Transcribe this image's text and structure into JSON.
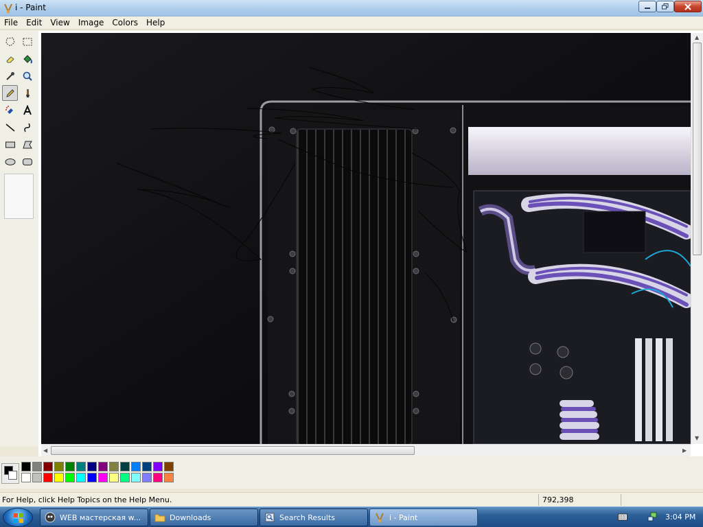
{
  "window": {
    "title": "i - Paint"
  },
  "menu": [
    "File",
    "Edit",
    "View",
    "Image",
    "Colors",
    "Help"
  ],
  "tools": [
    "free-form-select",
    "select",
    "eraser",
    "fill-with-color",
    "pick-color",
    "magnifier",
    "pencil",
    "brush",
    "airbrush",
    "text",
    "line",
    "curve",
    "rectangle",
    "polygon",
    "ellipse",
    "rounded-rectangle"
  ],
  "selected_tool": "pencil",
  "palette": {
    "foreground": "#000000",
    "background": "#ffffff",
    "row1": [
      "#000000",
      "#808080",
      "#800000",
      "#808000",
      "#008000",
      "#008080",
      "#000080",
      "#800080",
      "#808040",
      "#004040",
      "#0080ff",
      "#004080",
      "#8000ff",
      "#804000"
    ],
    "row2": [
      "#ffffff",
      "#c0c0c0",
      "#ff0000",
      "#ffff00",
      "#00ff00",
      "#00ffff",
      "#0000ff",
      "#ff00ff",
      "#ffff80",
      "#00ff80",
      "#80ffff",
      "#8080ff",
      "#ff0080",
      "#ff8040"
    ]
  },
  "status": {
    "help": "For Help, click Help Topics on the Help Menu.",
    "coords": "792,398"
  },
  "taskbar": {
    "items": [
      {
        "label": "WEB мастерская w...",
        "icon": "browser-icon"
      },
      {
        "label": "Downloads",
        "icon": "folder-icon"
      },
      {
        "label": "Search Results",
        "icon": "search-window-icon"
      },
      {
        "label": "i - Paint",
        "icon": "paint-icon"
      }
    ],
    "clock": "3:04 PM"
  }
}
